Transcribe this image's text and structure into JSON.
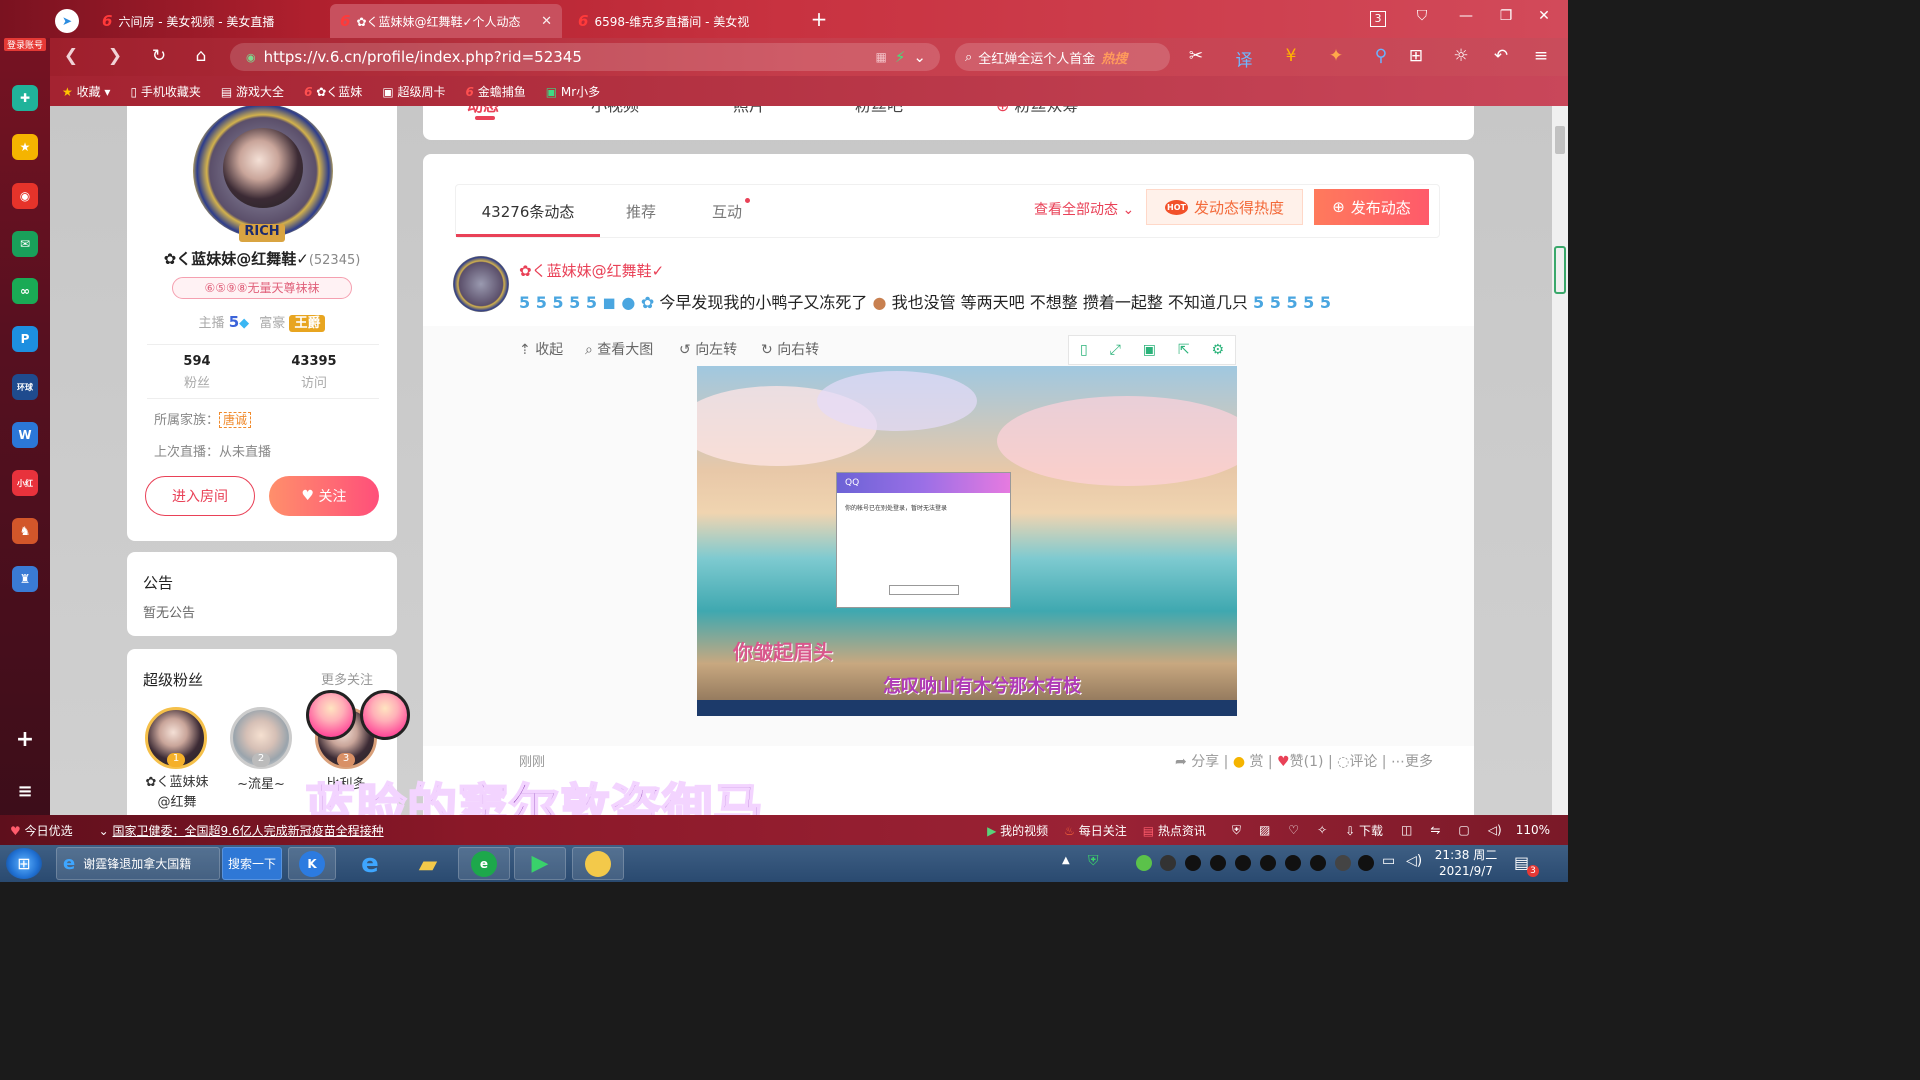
{
  "browser": {
    "tabs": [
      {
        "label": "六间房 - 美女视频 - 美女直播"
      },
      {
        "label": "✿く蓝妹妹@红舞鞋✓个人动态"
      },
      {
        "label": "6598-维克多直播间 - 美女视"
      }
    ],
    "tab_count": "3",
    "url": "https://v.6.cn/profile/index.php?rid=52345",
    "search_text": "全红婵全运个人首金",
    "search_hot": "热搜",
    "bookmarks": [
      "收藏",
      "手机收藏夹",
      "游戏大全",
      "✿く蓝妹",
      "超级周卡",
      "金蟾捕鱼",
      "Mr小多"
    ],
    "logo_label": "登录账号",
    "zoom": "110%"
  },
  "profile": {
    "rich_badge": "RICH",
    "name": "✿く蓝妹妹@红舞鞋✓",
    "rid": "(52345)",
    "title_badge": "⑥⑤⑨⑧无量天尊袜袜",
    "anchor_label": "主播",
    "anchor_level": "5",
    "rich_label": "富豪",
    "rich_level": "王爵",
    "fans_count": "594",
    "fans_label": "粉丝",
    "visits_count": "43395",
    "visits_label": "访问",
    "family_label": "所属家族：",
    "family_value": "唐诚",
    "last_live": "上次直播：从未直播",
    "enter_room": "进入房间",
    "follow": "关注"
  },
  "notice": {
    "title": "公告",
    "body": "暂无公告"
  },
  "superfans": {
    "title": "超级粉丝",
    "more": "更多关注",
    "fans": [
      {
        "rank": "1",
        "name": "✿く蓝妹妹@红舞"
      },
      {
        "rank": "2",
        "name": "~流星~"
      },
      {
        "rank": "3",
        "name": "比利多"
      }
    ]
  },
  "topnav": [
    "动态",
    "小视频",
    "照片",
    "粉丝吧",
    "粉丝众筹"
  ],
  "feed": {
    "tabs": [
      "43276条动态",
      "推荐",
      "互动"
    ],
    "view_all": "查看全部动态",
    "hot_btn": "发动态得热度",
    "hot_tag": "HOT",
    "publish_btn": "发布动态",
    "post": {
      "author": "✿く蓝妹妹@红舞鞋✓",
      "text_a": "今早发现我的小鸭子又冻死了",
      "text_b": "我也没管 等两天吧 不想整 攒着一起整 不知道几只",
      "toolbar": [
        "收起",
        "查看大图",
        "向左转",
        "向右转"
      ],
      "image_lyric1": "你皱起眉头",
      "image_lyric2": "怎叹呐山有木兮那木有枝",
      "qq_title": "QQ",
      "qq_msg": "你的帐号已在别处登录，暂时无法登录",
      "time": "刚刚",
      "actions": [
        "分享",
        "赏",
        "赞(1)",
        "评论",
        "更多"
      ]
    }
  },
  "overlay_caption": "蓝脸的窦尔敦盗御马",
  "statusbar": {
    "left": "今日优选",
    "news": "国家卫健委：全国超9.6亿人完成新冠疫苗全程接种",
    "items": [
      "我的视频",
      "每日关注",
      "热点资讯",
      "下载"
    ]
  },
  "taskbar": {
    "ie_item": "谢霆锋退加拿大国籍",
    "search_btn": "搜索一下",
    "time": "21:38 周二",
    "date": "2021/9/7",
    "notif": "3"
  }
}
